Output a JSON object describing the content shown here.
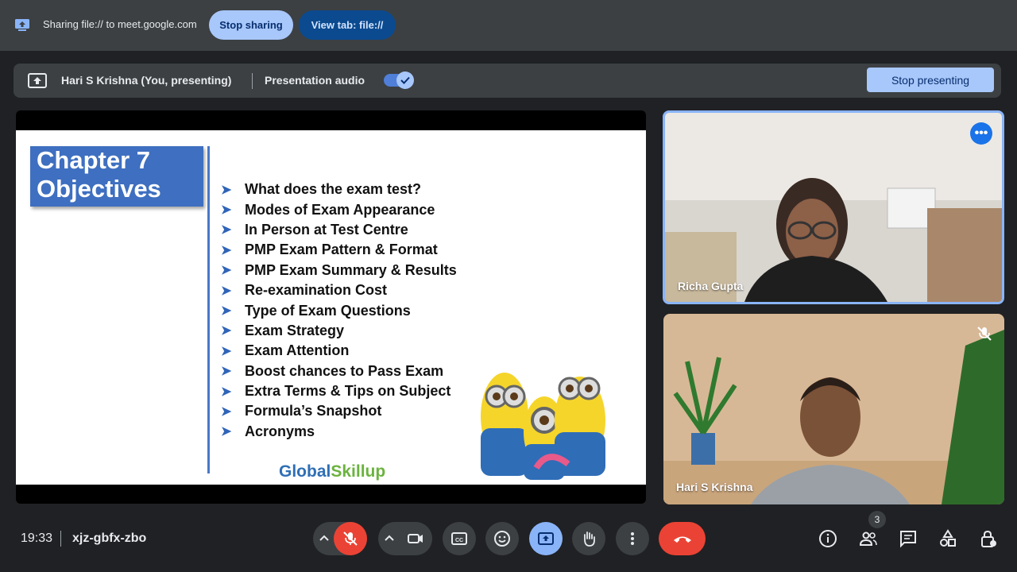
{
  "share_bar": {
    "sharing_text": "Sharing file:// to meet.google.com",
    "stop_sharing_label": "Stop sharing",
    "view_tab_label": "View tab: file://"
  },
  "presenting_bar": {
    "presenter": "Hari S Krishna (You, presenting)",
    "audio_label": "Presentation audio",
    "audio_enabled": true,
    "stop_presenting_label": "Stop presenting"
  },
  "slide": {
    "title_line1": "Chapter 7",
    "title_line2": "Objectives",
    "bullets": [
      "What does the exam test?",
      "Modes of Exam Appearance",
      "In Person at Test Centre",
      "PMP Exam Pattern & Format",
      "PMP Exam Summary & Results",
      "Re-examination Cost",
      "Type of Exam Questions",
      "Exam Strategy",
      "Exam Attention",
      "Boost chances to Pass Exam",
      "Extra Terms & Tips on Subject",
      "Formula’s Snapshot",
      "Acronyms"
    ],
    "logo_part1": "Global",
    "logo_part2": "Skillup"
  },
  "participants": [
    {
      "name": "Richa Gupta",
      "muted": false
    },
    {
      "name": "Hari S Krishna",
      "muted": true
    }
  ],
  "bottom_bar": {
    "time": "19:33",
    "meeting_code": "xjz-gbfx-zbo",
    "people_count": "3"
  },
  "colors": {
    "accent": "#a8c7fa",
    "end_call": "#ea4335",
    "slide_title_bg": "#3e6fc0"
  }
}
